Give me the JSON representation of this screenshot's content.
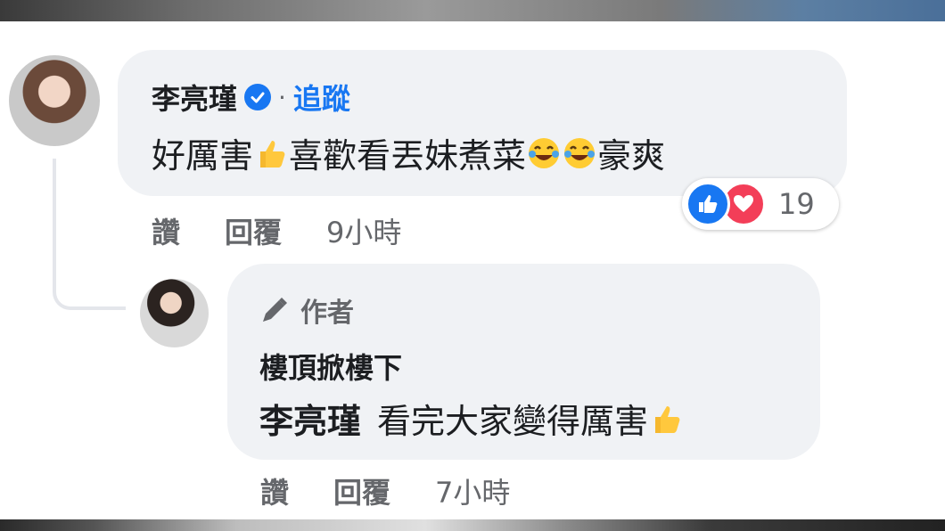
{
  "comment": {
    "author": "李亮瑾",
    "separator": "·",
    "follow_label": "追蹤",
    "text_part1": "好厲害",
    "text_part2": "喜歡看丟妹煮菜",
    "text_part3": "豪爽",
    "reaction_count": "19",
    "actions": {
      "like": "讚",
      "reply": "回覆",
      "time": "9小時"
    },
    "reactions": [
      "like-icon",
      "love-icon"
    ]
  },
  "reply": {
    "badge": "作者",
    "author": "樓頂掀樓下",
    "mention": "李亮瑾",
    "text": "看完大家變得厲害",
    "actions": {
      "like": "讚",
      "reply": "回覆",
      "time": "7小時"
    }
  },
  "colors": {
    "bubble": "#f0f2f5",
    "link": "#1877f2",
    "muted": "#65676b",
    "love": "#f33e58"
  }
}
